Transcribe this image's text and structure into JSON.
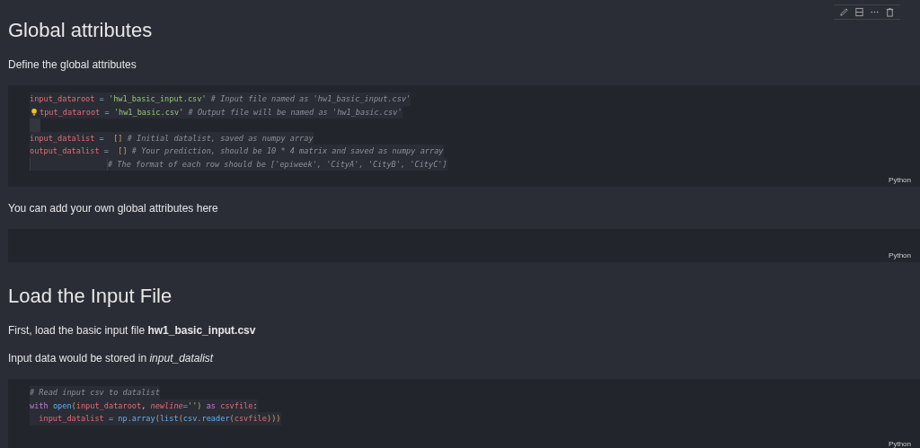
{
  "cells": [
    {
      "kind": "heading",
      "text": "Global attributes"
    },
    {
      "kind": "paragraph",
      "text": "Define the global attributes"
    },
    {
      "kind": "code",
      "language": "Python",
      "lines": [
        {
          "tokens": [
            {
              "kind": "var",
              "text": "input_dataroot"
            },
            {
              "kind": "op",
              "text": " = "
            },
            {
              "kind": "str",
              "text": "'hw1_basic_input.csv'"
            },
            {
              "kind": "comment",
              "text": " # Input file named as 'hw1_basic_input.csv'"
            }
          ]
        },
        {
          "tokens": [
            {
              "kind": "bulb"
            },
            {
              "kind": "var",
              "text": "tput_dataroot"
            },
            {
              "kind": "op",
              "text": " = "
            },
            {
              "kind": "str",
              "text": "'hw1_basic.csv'"
            },
            {
              "kind": "comment",
              "text": " # Output file will be named as 'hw1_basic.csv'"
            }
          ]
        },
        {
          "blank": true
        },
        {
          "tokens": [
            {
              "kind": "var",
              "text": "input_datalist"
            },
            {
              "kind": "op",
              "text": " =  "
            },
            {
              "kind": "bracket",
              "text": "[]"
            },
            {
              "kind": "comment",
              "text": " # Initial datalist, saved as numpy array"
            }
          ]
        },
        {
          "tokens": [
            {
              "kind": "var",
              "text": "output_datalist"
            },
            {
              "kind": "op",
              "text": " =  "
            },
            {
              "kind": "bracket",
              "text": "[]"
            },
            {
              "kind": "comment",
              "text": " # Your prediction, should be 10 * 4 matrix and saved as numpy array"
            }
          ]
        },
        {
          "tokens": [
            {
              "kind": "indent"
            },
            {
              "kind": "comment",
              "text": "# The format of each row should be ['epiweek', 'CityA', 'CityB', 'CityC']"
            }
          ]
        }
      ]
    },
    {
      "kind": "paragraph",
      "text": "You can add your own global attributes here"
    },
    {
      "kind": "code",
      "language": "Python"
    },
    {
      "kind": "heading",
      "text": "Load the Input File"
    },
    {
      "kind": "paragraph",
      "text": "First, load the basic input file **hw1_basic_input.csv**"
    },
    {
      "kind": "paragraph",
      "text": "Input data would be stored in *input_datalist*"
    },
    {
      "kind": "code",
      "language": "Python",
      "lines": [
        {
          "tokens": [
            {
              "kind": "comment",
              "text": "# Read input csv to datalist"
            }
          ]
        },
        {
          "tokens": [
            {
              "kind": "kw",
              "text": "with"
            },
            {
              "kind": "fn",
              "text": " open"
            },
            {
              "kind": "bracket",
              "text": "("
            },
            {
              "kind": "var",
              "text": "input_dataroot"
            },
            {
              "kind": "plain",
              "text": ", "
            },
            {
              "kind": "param",
              "text": "newline"
            },
            {
              "kind": "op",
              "text": "="
            },
            {
              "kind": "str",
              "text": "''"
            },
            {
              "kind": "bracket",
              "text": ")"
            },
            {
              "kind": "kw",
              "text": " as"
            },
            {
              "kind": "var",
              "text": " csvfile"
            },
            {
              "kind": "plain",
              "text": ":"
            }
          ]
        },
        {
          "tokens": [
            {
              "kind": "var",
              "text": "  input_datalist"
            },
            {
              "kind": "op",
              "text": " = "
            },
            {
              "kind": "fn",
              "text": "np.array"
            },
            {
              "kind": "bracket",
              "text": "("
            },
            {
              "kind": "fn",
              "text": "list"
            },
            {
              "kind": "bracket",
              "text": "("
            },
            {
              "kind": "fn",
              "text": "csv.reader"
            },
            {
              "kind": "bracket",
              "text": "("
            },
            {
              "kind": "var",
              "text": "csvfile"
            },
            {
              "kind": "bracket",
              "text": ")))"
            }
          ]
        }
      ]
    }
  ]
}
